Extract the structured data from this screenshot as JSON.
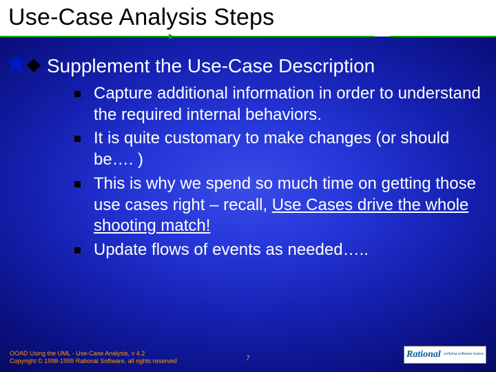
{
  "title": "Use-Case Analysis Steps",
  "heading": "Supplement the Use-Case Description",
  "bullets": {
    "b0": "Capture additional information in order to understand the required internal behaviors.",
    "b1": "It is quite customary to make changes (or should be…. )",
    "b2a": "This is why we spend so much time on getting those use cases right – recall, ",
    "b2b": "Use Cases drive the whole shooting match!",
    "b3": "Update flows of events as needed….."
  },
  "footer": {
    "line1": "OOAD Using the UML - Use-Case Analysis, v 4.2",
    "line2": "Copyright © 1998-1999 Rational Software, all rights reserved",
    "page": "7",
    "logo_main": "Rational",
    "logo_tag": "unifying software teams"
  }
}
